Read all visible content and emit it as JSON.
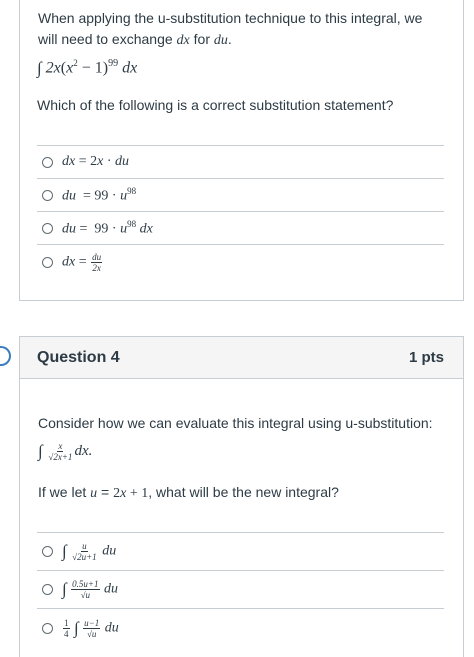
{
  "question3": {
    "intro": "When applying the u-substitution technique to this integral, we will need to exchange dx for du.",
    "integral": "∫ 2x(x² − 1)⁹⁹ dx",
    "prompt": "Which of the following is a correct substitution statement?",
    "answers": [
      "dx = 2x · du",
      "du = 99 · u⁹⁸",
      "du = 99 · u⁹⁸ dx",
      "dx = du / 2x"
    ]
  },
  "question4": {
    "title": "Question 4",
    "points": "1 pts",
    "intro": "Consider how we can evaluate this integral using u-substitution:",
    "integral": "∫ x/√(2x+1) dx.",
    "prompt": "If we let u = 2x + 1, what will be the new integral?",
    "answers": [
      "∫ u/√(2u+1) du",
      "∫ (0.5u+1)/√u du",
      "1/4 ∫ (u−1)/√u du"
    ]
  }
}
